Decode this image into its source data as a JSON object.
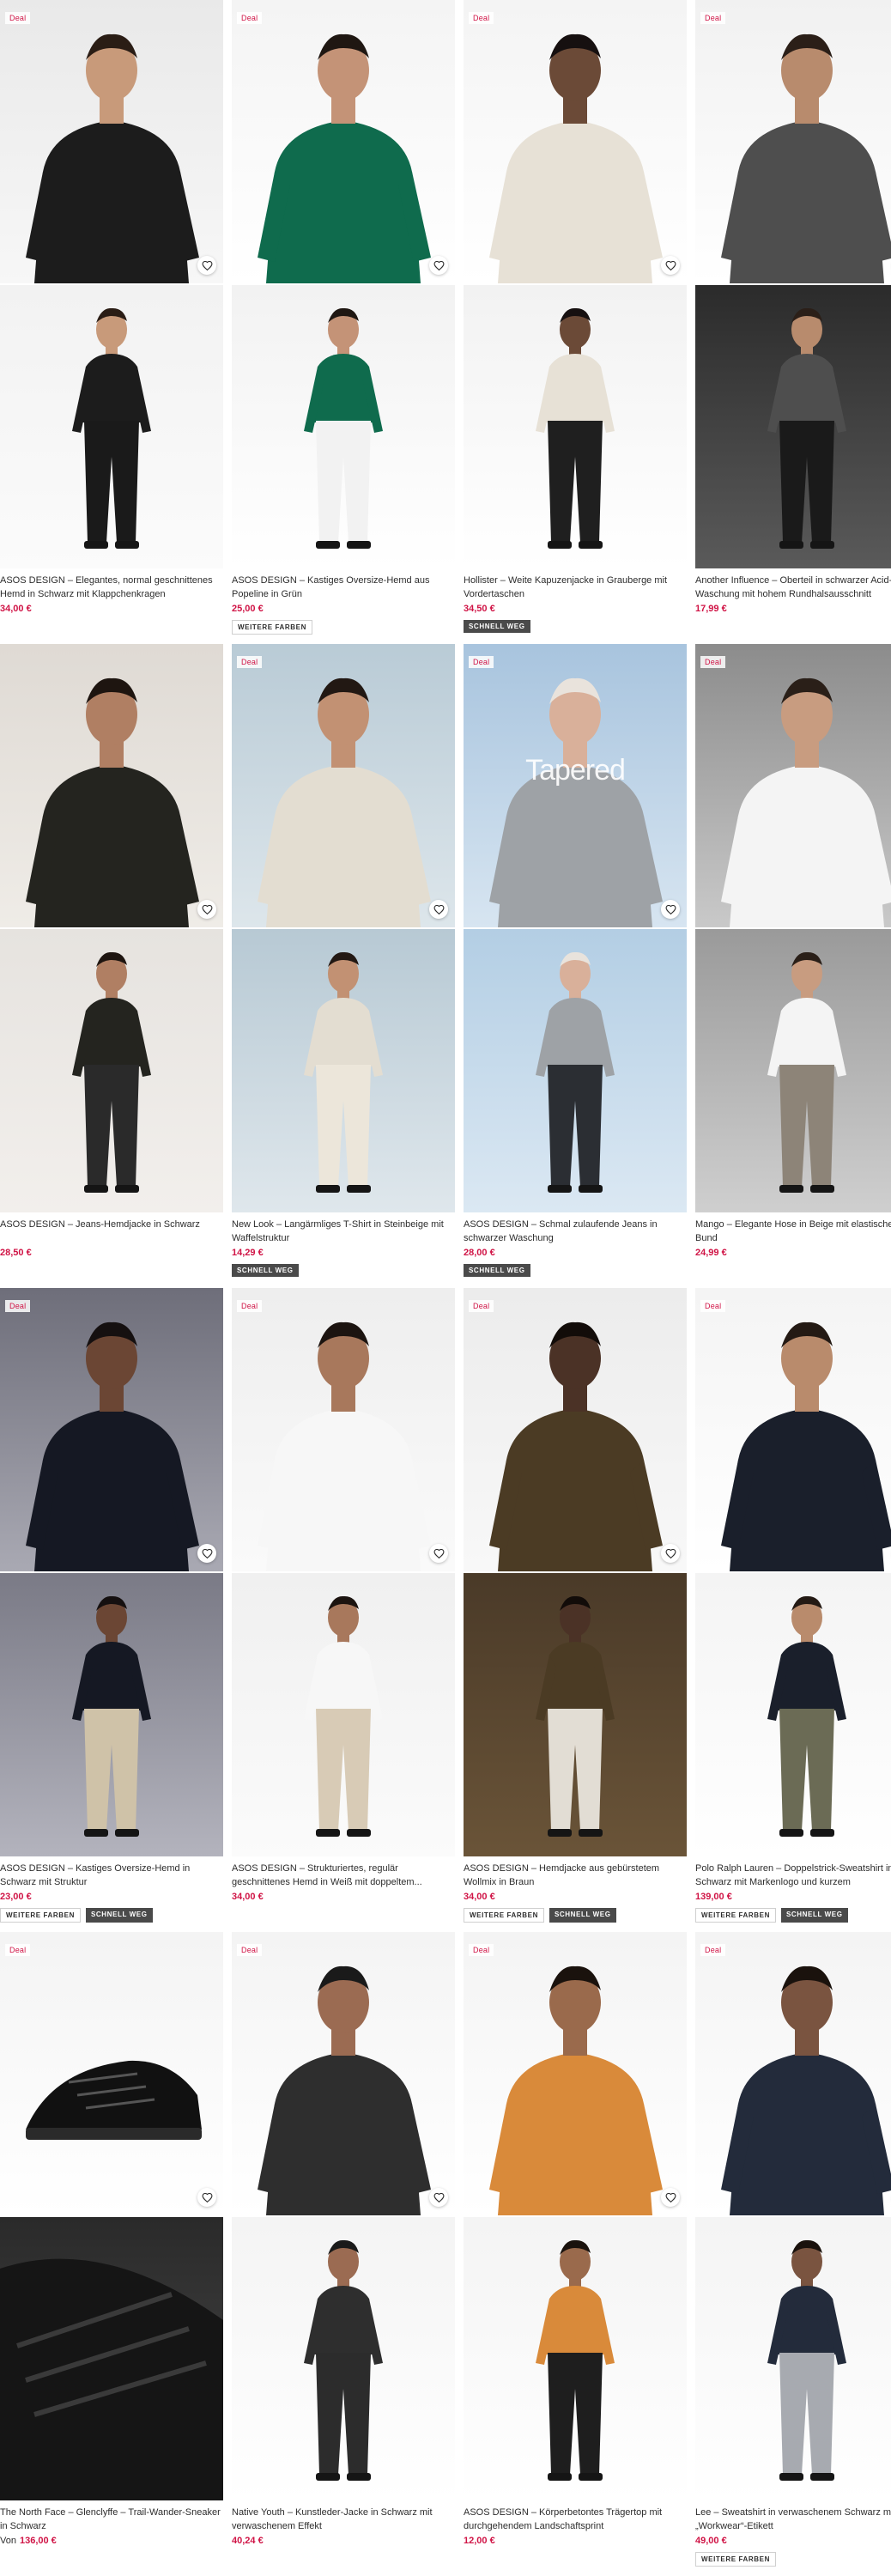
{
  "labels": {
    "deal": "Deal",
    "more_colors": "WEITERE FARBEN",
    "fast": "SCHNELL WEG",
    "from": "Von"
  },
  "products": [
    {
      "title": "ASOS DESIGN – Elegantes, normal geschnittenes Hemd in Schwarz mit Klappchenkragen",
      "price": "34,00 €",
      "deal": true,
      "colors": false,
      "fast": false,
      "overlay": ""
    },
    {
      "title": "ASOS DESIGN – Kastiges Oversize-Hemd aus Popeline in Grün",
      "price": "25,00 €",
      "deal": true,
      "colors": true,
      "fast": false,
      "overlay": ""
    },
    {
      "title": "Hollister – Weite Kapuzenjacke in Grauberge mit Vordertaschen",
      "price": "34,50 €",
      "deal": true,
      "colors": false,
      "fast": true,
      "overlay": ""
    },
    {
      "title": "Another Influence – Oberteil in schwarzer Acid-Waschung mit hohem Rundhalsausschnitt",
      "price": "17,99 €",
      "deal": true,
      "colors": false,
      "fast": false,
      "overlay": ""
    },
    {
      "title": "ASOS DESIGN – Jeans-Hemdjacke in Schwarz",
      "price": "28,50 €",
      "deal": false,
      "colors": false,
      "fast": false,
      "overlay": ""
    },
    {
      "title": "New Look – Langärmliges T-Shirt in Steinbeige mit Waffelstruktur",
      "price": "14,29 €",
      "deal": true,
      "colors": false,
      "fast": true,
      "overlay": ""
    },
    {
      "title": "ASOS DESIGN – Schmal zulaufende Jeans in schwarzer Waschung",
      "price": "28,00 €",
      "deal": true,
      "colors": false,
      "fast": true,
      "overlay": "Tapered"
    },
    {
      "title": "Mango – Elegante Hose in Beige mit elastischem Bund",
      "price": "24,99 €",
      "deal": true,
      "colors": false,
      "fast": false,
      "overlay": ""
    },
    {
      "title": "ASOS DESIGN – Kastiges Oversize-Hemd in Schwarz mit Struktur",
      "price": "23,00 €",
      "deal": true,
      "colors": true,
      "fast": true,
      "overlay": ""
    },
    {
      "title": "ASOS DESIGN – Strukturiertes, regulär geschnittenes Hemd in Weiß mit doppeltem...",
      "price": "34,00 €",
      "deal": true,
      "colors": false,
      "fast": false,
      "overlay": ""
    },
    {
      "title": "ASOS DESIGN – Hemdjacke aus gebürstetem Wollmix in Braun",
      "price": "34,00 €",
      "deal": true,
      "colors": true,
      "fast": true,
      "overlay": ""
    },
    {
      "title": "Polo Ralph Lauren – Doppelstrick-Sweatshirt in Schwarz mit Markenlogo und kurzem Reißverschluss",
      "price": "139,00 €",
      "deal": true,
      "colors": true,
      "fast": true,
      "overlay": ""
    },
    {
      "title": "The North Face – Glenclyffe – Trail-Wander-Sneaker in Schwarz",
      "price": "136,00 €",
      "price_prefix": true,
      "deal": true,
      "colors": false,
      "fast": false,
      "overlay": ""
    },
    {
      "title": "Native Youth – Kunstleder-Jacke in Schwarz mit verwaschenem Effekt",
      "price": "40,24 €",
      "deal": true,
      "colors": false,
      "fast": false,
      "overlay": ""
    },
    {
      "title": "ASOS DESIGN – Körperbetontes Trägertop mit durchgehendem Landschaftsprint",
      "price": "12,00 €",
      "deal": true,
      "colors": false,
      "fast": false,
      "overlay": ""
    },
    {
      "title": "Lee – Sweatshirt in verwaschenem Schwarz mit „Workwear“-Etikett",
      "price": "49,00 €",
      "deal": true,
      "colors": true,
      "fast": false,
      "overlay": ""
    }
  ],
  "colors": {
    "sale_red": "#d01345",
    "text": "#2d2d2d",
    "badge_dark": "#4a4a4a"
  }
}
